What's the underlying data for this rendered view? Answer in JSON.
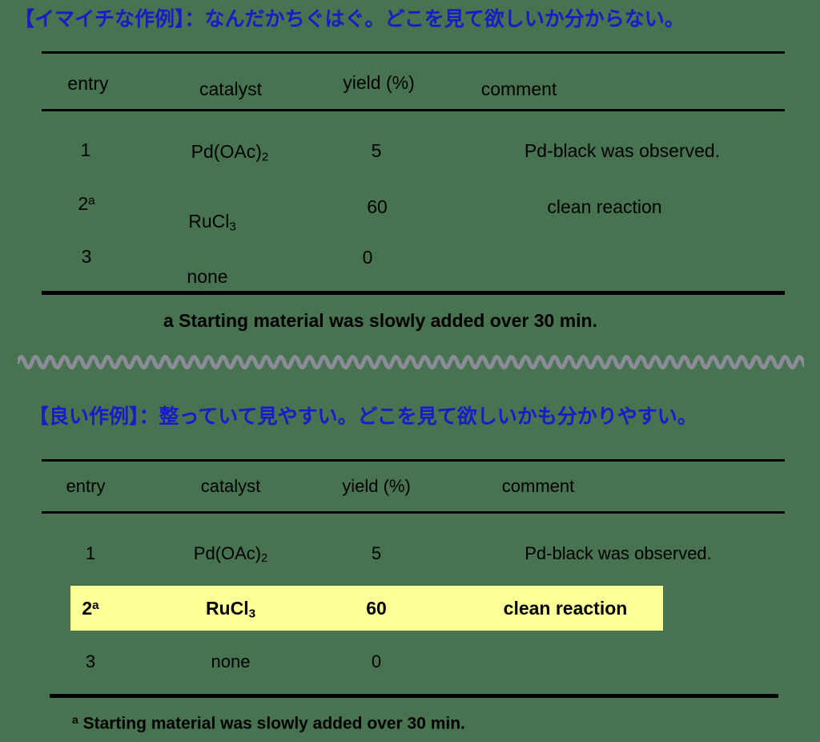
{
  "background_color": "#477350",
  "heading_color": "#1a1ac8",
  "highlight_color": "#ffff99",
  "rule_color": "#000000",
  "divider": {
    "name": "wavy-divider",
    "color": "#8c8c99"
  },
  "bad_example": {
    "heading": "【イマイチな作例】：なんだかちぐはぐ。どこを見て欲しいか分からない。",
    "columns": [
      "entry",
      "catalyst",
      "yield (%)",
      "comment"
    ],
    "rows": [
      {
        "entry": "1",
        "entry_sup": "",
        "catalyst": "Pd(OAc)",
        "catalyst_sub": "2",
        "yield": "5",
        "comment": "Pd-black was observed."
      },
      {
        "entry": "2",
        "entry_sup": "a",
        "catalyst": "RuCl",
        "catalyst_sub": "3",
        "yield": "60",
        "comment": "clean reaction"
      },
      {
        "entry": "3",
        "entry_sup": "",
        "catalyst": "none",
        "catalyst_sub": "",
        "yield": "0",
        "comment": ""
      }
    ],
    "footnote": "a Starting material was slowly added over 30 min."
  },
  "good_example": {
    "heading": "【良い作例】：整っていて見やすい。どこを見て欲しいかも分かりやすい。",
    "columns": [
      "entry",
      "catalyst",
      "yield (%)",
      "comment"
    ],
    "rows": [
      {
        "entry": "1",
        "entry_sup": "",
        "catalyst": "Pd(OAc)",
        "catalyst_sub": "2",
        "yield": "5",
        "comment": "Pd-black was observed.",
        "highlighted": false
      },
      {
        "entry": "2",
        "entry_sup": "a",
        "catalyst": "RuCl",
        "catalyst_sub": "3",
        "yield": "60",
        "comment": "clean reaction",
        "highlighted": true
      },
      {
        "entry": "3",
        "entry_sup": "",
        "catalyst": "none",
        "catalyst_sub": "",
        "yield": "0",
        "comment": "",
        "highlighted": false
      }
    ],
    "footnote_sup": "a",
    "footnote": "Starting material was slowly added over 30 min."
  }
}
